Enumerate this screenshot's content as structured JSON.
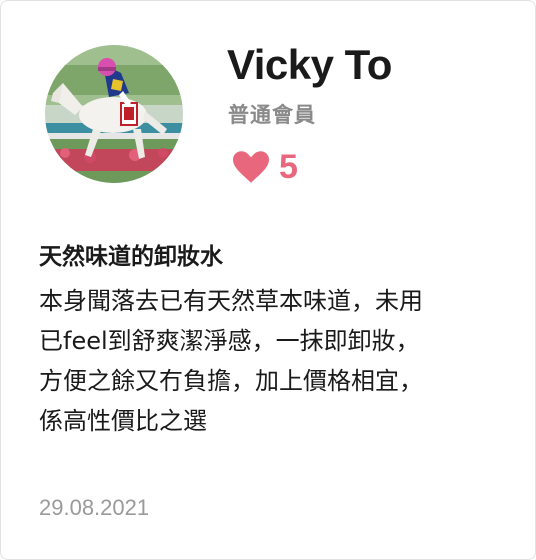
{
  "review": {
    "user_name": "Vicky To",
    "user_role": "普通會員",
    "like_count": "5",
    "title": "天然味道的卸妝水",
    "body_lines": [
      "本身聞落去已有天然草本味道，未用",
      "已feel到舒爽潔淨感，一抹即卸妝，",
      "方便之餘又冇負擔，加上價格相宜，",
      "係高性價比之選"
    ],
    "date": "29.08.2021"
  },
  "icons": {
    "like": "heart-icon",
    "avatar": "avatar-photo-jockey-on-horse"
  },
  "colors": {
    "like_accent": "#e8677d",
    "secondary_text": "#8a8a8a",
    "date_text": "#9a9a9a",
    "card_border": "#e1e1e1"
  }
}
